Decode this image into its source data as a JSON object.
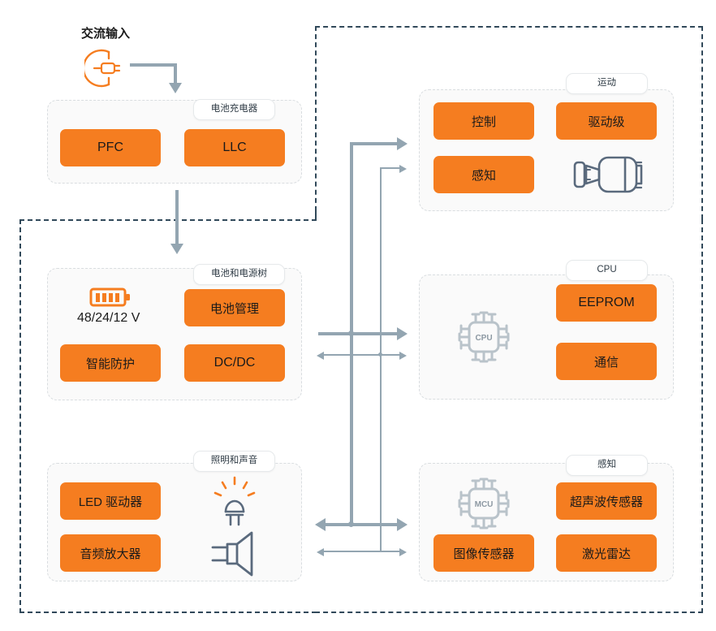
{
  "diagram": {
    "title_text": "交流输入",
    "colors": {
      "accent_orange": "#f57d20",
      "boundary_dash": "#31495a",
      "panel_dash": "#d9dde0",
      "wire": "#93a5b1",
      "icon_gray": "#5a6a7d",
      "chip_gray": "#b9c3ca"
    },
    "ac_input": {
      "label": "交流输入",
      "icon": "power-plug-icon"
    },
    "panels": [
      {
        "id": "battery-charger",
        "label": "电池充电器",
        "blocks": [
          {
            "label": "PFC",
            "script": "latin"
          },
          {
            "label": "LLC",
            "script": "latin"
          }
        ],
        "icons": []
      },
      {
        "id": "battery-power-tree",
        "label": "电池和电源树",
        "blocks": [
          {
            "label": "电池管理",
            "script": "cjk"
          },
          {
            "label": "智能防护",
            "script": "cjk"
          },
          {
            "label": "DC/DC",
            "script": "latin"
          }
        ],
        "icons": [
          {
            "name": "battery-icon",
            "caption": "48/24/12 V"
          }
        ]
      },
      {
        "id": "lighting-and-sound",
        "label": "照明和声音",
        "blocks": [
          {
            "label": "LED 驱动器",
            "script": "cjk"
          },
          {
            "label": "音频放大器",
            "script": "cjk"
          }
        ],
        "icons": [
          {
            "name": "led-lamp-icon",
            "caption": ""
          },
          {
            "name": "speaker-icon",
            "caption": ""
          }
        ]
      },
      {
        "id": "motion",
        "label": "运动",
        "blocks": [
          {
            "label": "控制",
            "script": "cjk"
          },
          {
            "label": "驱动级",
            "script": "cjk"
          },
          {
            "label": "感知",
            "script": "cjk"
          }
        ],
        "icons": [
          {
            "name": "motor-icon",
            "caption": ""
          }
        ]
      },
      {
        "id": "cpu",
        "label": "CPU",
        "blocks": [
          {
            "label": "EEPROM",
            "script": "latin"
          },
          {
            "label": "通信",
            "script": "cjk"
          }
        ],
        "icons": [
          {
            "name": "cpu-chip-icon",
            "caption": "CPU"
          }
        ]
      },
      {
        "id": "sensing",
        "label": "感知",
        "blocks": [
          {
            "label": "超声波传感器",
            "script": "cjk"
          },
          {
            "label": "图像传感器",
            "script": "cjk"
          },
          {
            "label": "激光雷达",
            "script": "cjk"
          }
        ],
        "icons": [
          {
            "name": "mcu-chip-icon",
            "caption": "MCU"
          }
        ]
      }
    ],
    "chip_labels": {
      "cpu": "CPU",
      "mcu": "MCU"
    },
    "battery_voltage": "48/24/12 V"
  }
}
